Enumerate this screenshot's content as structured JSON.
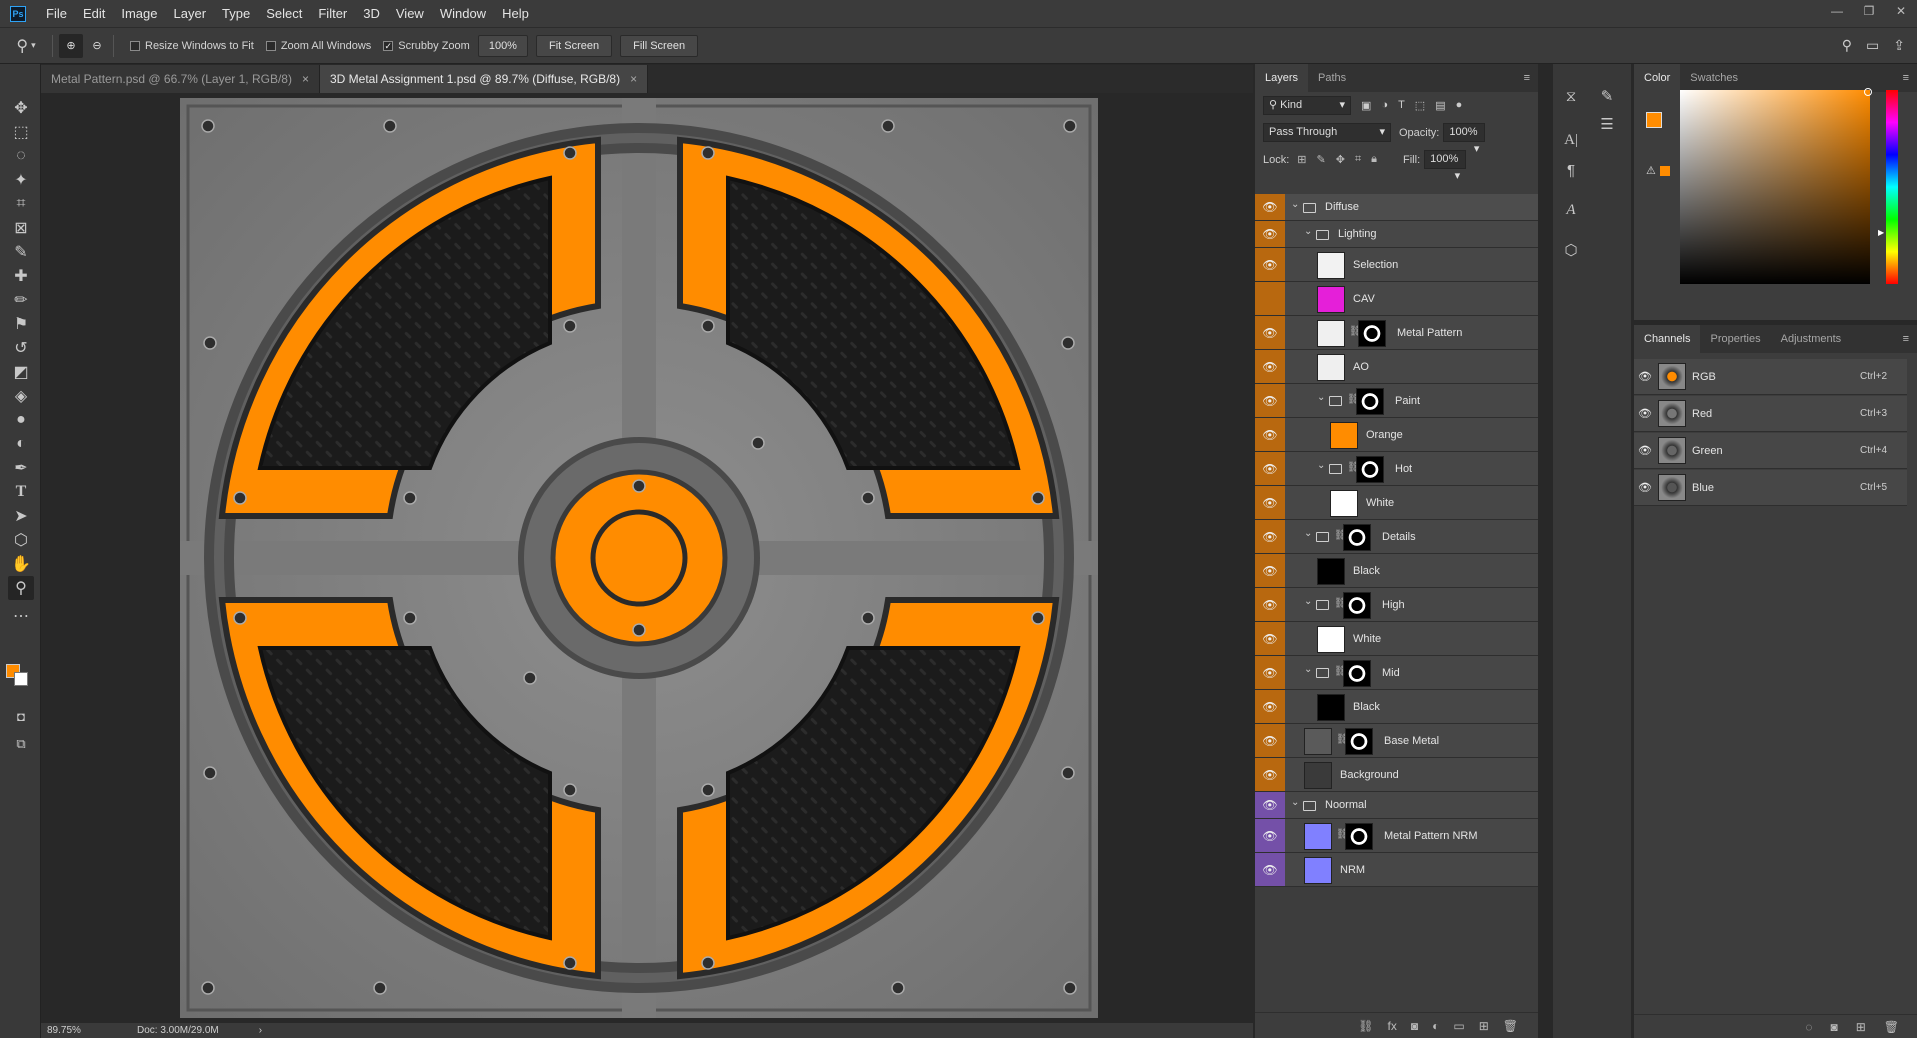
{
  "app": {
    "logo": "Ps"
  },
  "menu": [
    "File",
    "Edit",
    "Image",
    "Layer",
    "Type",
    "Select",
    "Filter",
    "3D",
    "View",
    "Window",
    "Help"
  ],
  "window_controls": [
    "minimize-icon",
    "restore-icon",
    "close-icon"
  ],
  "options": {
    "resize_windows": "Resize Windows to Fit",
    "zoom_all": "Zoom All Windows",
    "scrubby": "Scrubby Zoom",
    "zoom_value": "100%",
    "fit_screen": "Fit Screen",
    "fill_screen": "Fill Screen"
  },
  "tabs": [
    {
      "label": "Metal Pattern.psd @ 66.7% (Layer 1, RGB/8)",
      "active": false
    },
    {
      "label": "3D Metal Assignment 1.psd @ 89.7% (Diffuse, RGB/8)",
      "active": true
    }
  ],
  "status": {
    "zoom": "89.75%",
    "doc": "Doc: 3.00M/29.0M",
    "arrow": "›"
  },
  "layers_panel": {
    "tabs": [
      "Layers",
      "Paths"
    ],
    "filter": "Kind",
    "blend_mode": "Pass Through",
    "opacity_label": "Opacity:",
    "opacity": "100%",
    "lock_label": "Lock:",
    "fill_label": "Fill:",
    "fill": "100%",
    "layers": [
      {
        "name": "Diffuse",
        "depth": 0,
        "type": "group",
        "tag": "orange"
      },
      {
        "name": "Lighting",
        "depth": 1,
        "type": "group",
        "tag": "orange"
      },
      {
        "name": "Selection",
        "depth": 2,
        "type": "layer",
        "thumb": "#f2f2f2",
        "tag": "orange"
      },
      {
        "name": "CAV",
        "depth": 2,
        "type": "layer",
        "thumb": "#e51fd9",
        "tag": "orange",
        "hidden": true
      },
      {
        "name": "Metal Pattern",
        "depth": 2,
        "type": "layer",
        "thumb": "#f0f0f0",
        "mask": true,
        "tag": "orange"
      },
      {
        "name": "AO",
        "depth": 2,
        "type": "layer",
        "thumb": "#efefef",
        "tag": "orange"
      },
      {
        "name": "Paint",
        "depth": 2,
        "type": "group",
        "mask": true,
        "tag": "orange"
      },
      {
        "name": "Orange",
        "depth": 3,
        "type": "layer",
        "thumb": "#ff8c00",
        "tag": "orange"
      },
      {
        "name": "Hot",
        "depth": 2,
        "type": "group",
        "mask": true,
        "tag": "orange"
      },
      {
        "name": "White",
        "depth": 3,
        "type": "layer",
        "thumb": "#ffffff",
        "tag": "orange"
      },
      {
        "name": "Details",
        "depth": 1,
        "type": "group",
        "mask": true,
        "tag": "orange"
      },
      {
        "name": "Black",
        "depth": 2,
        "type": "layer",
        "thumb": "#000000",
        "tag": "orange"
      },
      {
        "name": "High",
        "depth": 1,
        "type": "group",
        "mask": true,
        "tag": "orange"
      },
      {
        "name": "White",
        "depth": 2,
        "type": "layer",
        "thumb": "#ffffff",
        "tag": "orange"
      },
      {
        "name": "Mid",
        "depth": 1,
        "type": "group",
        "mask": true,
        "tag": "orange"
      },
      {
        "name": "Black",
        "depth": 2,
        "type": "layer",
        "thumb": "#000000",
        "tag": "orange"
      },
      {
        "name": "Base Metal",
        "depth": 1,
        "type": "layer",
        "thumb": "#5a5a5a",
        "mask": true,
        "tag": "orange"
      },
      {
        "name": "Background",
        "depth": 1,
        "type": "layer",
        "thumb": "#3a3a3a",
        "tag": "orange"
      },
      {
        "name": "Noormal",
        "depth": 0,
        "type": "group",
        "tag": "violet"
      },
      {
        "name": "Metal Pattern NRM",
        "depth": 1,
        "type": "layer",
        "thumb": "#8080ff",
        "mask": true,
        "tag": "violet"
      },
      {
        "name": "NRM",
        "depth": 1,
        "type": "layer",
        "thumb": "#8080ff",
        "tag": "violet"
      }
    ]
  },
  "color_panel": {
    "tabs": [
      "Color",
      "Swatches"
    ],
    "foreground": "#ff8c00",
    "background": "#ffffff",
    "hue": "#ff8c00"
  },
  "channels_panel": {
    "tabs": [
      "Channels",
      "Properties",
      "Adjustments"
    ],
    "channels": [
      {
        "name": "RGB",
        "key": "Ctrl+2"
      },
      {
        "name": "Red",
        "key": "Ctrl+3"
      },
      {
        "name": "Green",
        "key": "Ctrl+4"
      },
      {
        "name": "Blue",
        "key": "Ctrl+5"
      }
    ]
  },
  "colors": {
    "accent_orange": "#ff8c00",
    "tag_orange": "#b8680f",
    "tag_violet": "#7450a8",
    "panel": "#3d3d3d"
  }
}
